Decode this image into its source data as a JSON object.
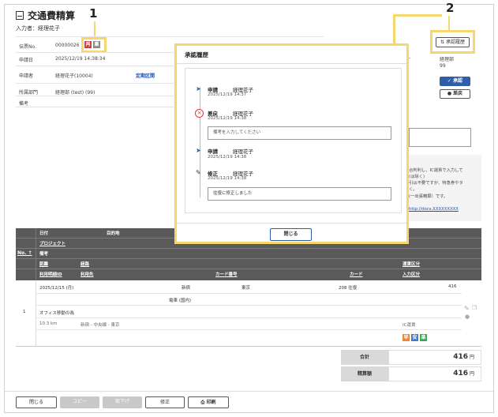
{
  "page": {
    "title": "交通費精算",
    "input_by": "入力者：経理花子"
  },
  "callouts": {
    "one": "1",
    "two": "2"
  },
  "header_fields": {
    "slip_no_label": "伝票No.",
    "slip_no_value": "00000026",
    "badge_red": "再",
    "badge_gray": "稟",
    "apply_date_label": "申請日",
    "apply_date_value": "2025/12/19 14:38:34",
    "applicant_label": "申請者",
    "applicant_value": "経理花子(10004)",
    "route_link": "定期区間",
    "dept_label": "所属部門",
    "dept_value": "経理部 (test) (99)",
    "note_label": "備考"
  },
  "right_panel": {
    "history_button": "承認履歴",
    "dept_line1": "経理部",
    "dept_line2": "99",
    "approve_button": "承認",
    "reject_button": "差戻",
    "info_lines": [
      "合判利し、IC運賃で入力して",
      "(は除く)",
      "引は不要ですが、特急券やタ",
      "く。",
      "(一出張精算）です。"
    ],
    "info_link": "http://docs.XXXXXXXXX"
  },
  "modal": {
    "title": "承認履歴",
    "entries": [
      {
        "action": "申請",
        "name": "経理花子",
        "date": "2025/12/19 14:37"
      },
      {
        "action": "差戻",
        "name": "経理花子",
        "date": "2025/12/19 14:38",
        "comment_placeholder": "備考を入力してください"
      },
      {
        "action": "申請",
        "name": "経理花子",
        "date": "2025/12/19 14:38"
      },
      {
        "action": "修正",
        "name": "経理花子",
        "date": "2025/12/19 14:38",
        "comment": "往復に修正しました"
      }
    ],
    "close_button": "閉じる"
  },
  "table": {
    "no_header": "No.",
    "headers": {
      "date": "日付",
      "destination": "目的地",
      "project": "プロジェクト",
      "note": "備考",
      "distance": "距離",
      "route": "経路",
      "fare_type": "運賃区分",
      "usage_id": "利用明細ID",
      "usage_place": "利用先",
      "card_no": "カード番号",
      "card": "カード",
      "input_type": "入力区分"
    },
    "row": {
      "no": "1",
      "date": "2025/12/15 (月)",
      "from": "新宿",
      "to": "東京",
      "amount_info": "208 往復",
      "amount": "416",
      "transport": "電車 (国内)",
      "purpose": "オフィス移動の為",
      "distance": "10.3 km",
      "route": "新宿 - 中央線 - 東京",
      "fare_type": "IC運賃",
      "tag_1": "早",
      "tag_2": "安",
      "tag_3": "楽"
    }
  },
  "totals": {
    "total_label": "合計",
    "total_value": "416",
    "total_unit": "円",
    "settle_label": "精算額",
    "settle_value": "416",
    "settle_unit": "円"
  },
  "footer": {
    "close": "閉じる",
    "copy": "コピー",
    "withdraw": "取下げ",
    "edit": "修正",
    "print": "印刷"
  },
  "colors": {
    "highlight": "#f5d76e",
    "header_gray": "#5a5a5a",
    "accent_blue": "#2f5ea8",
    "badge_red": "#d93a3a",
    "tag_orange": "#e8873a",
    "tag_blue": "#3a7bd5",
    "tag_green": "#3aa35a"
  }
}
